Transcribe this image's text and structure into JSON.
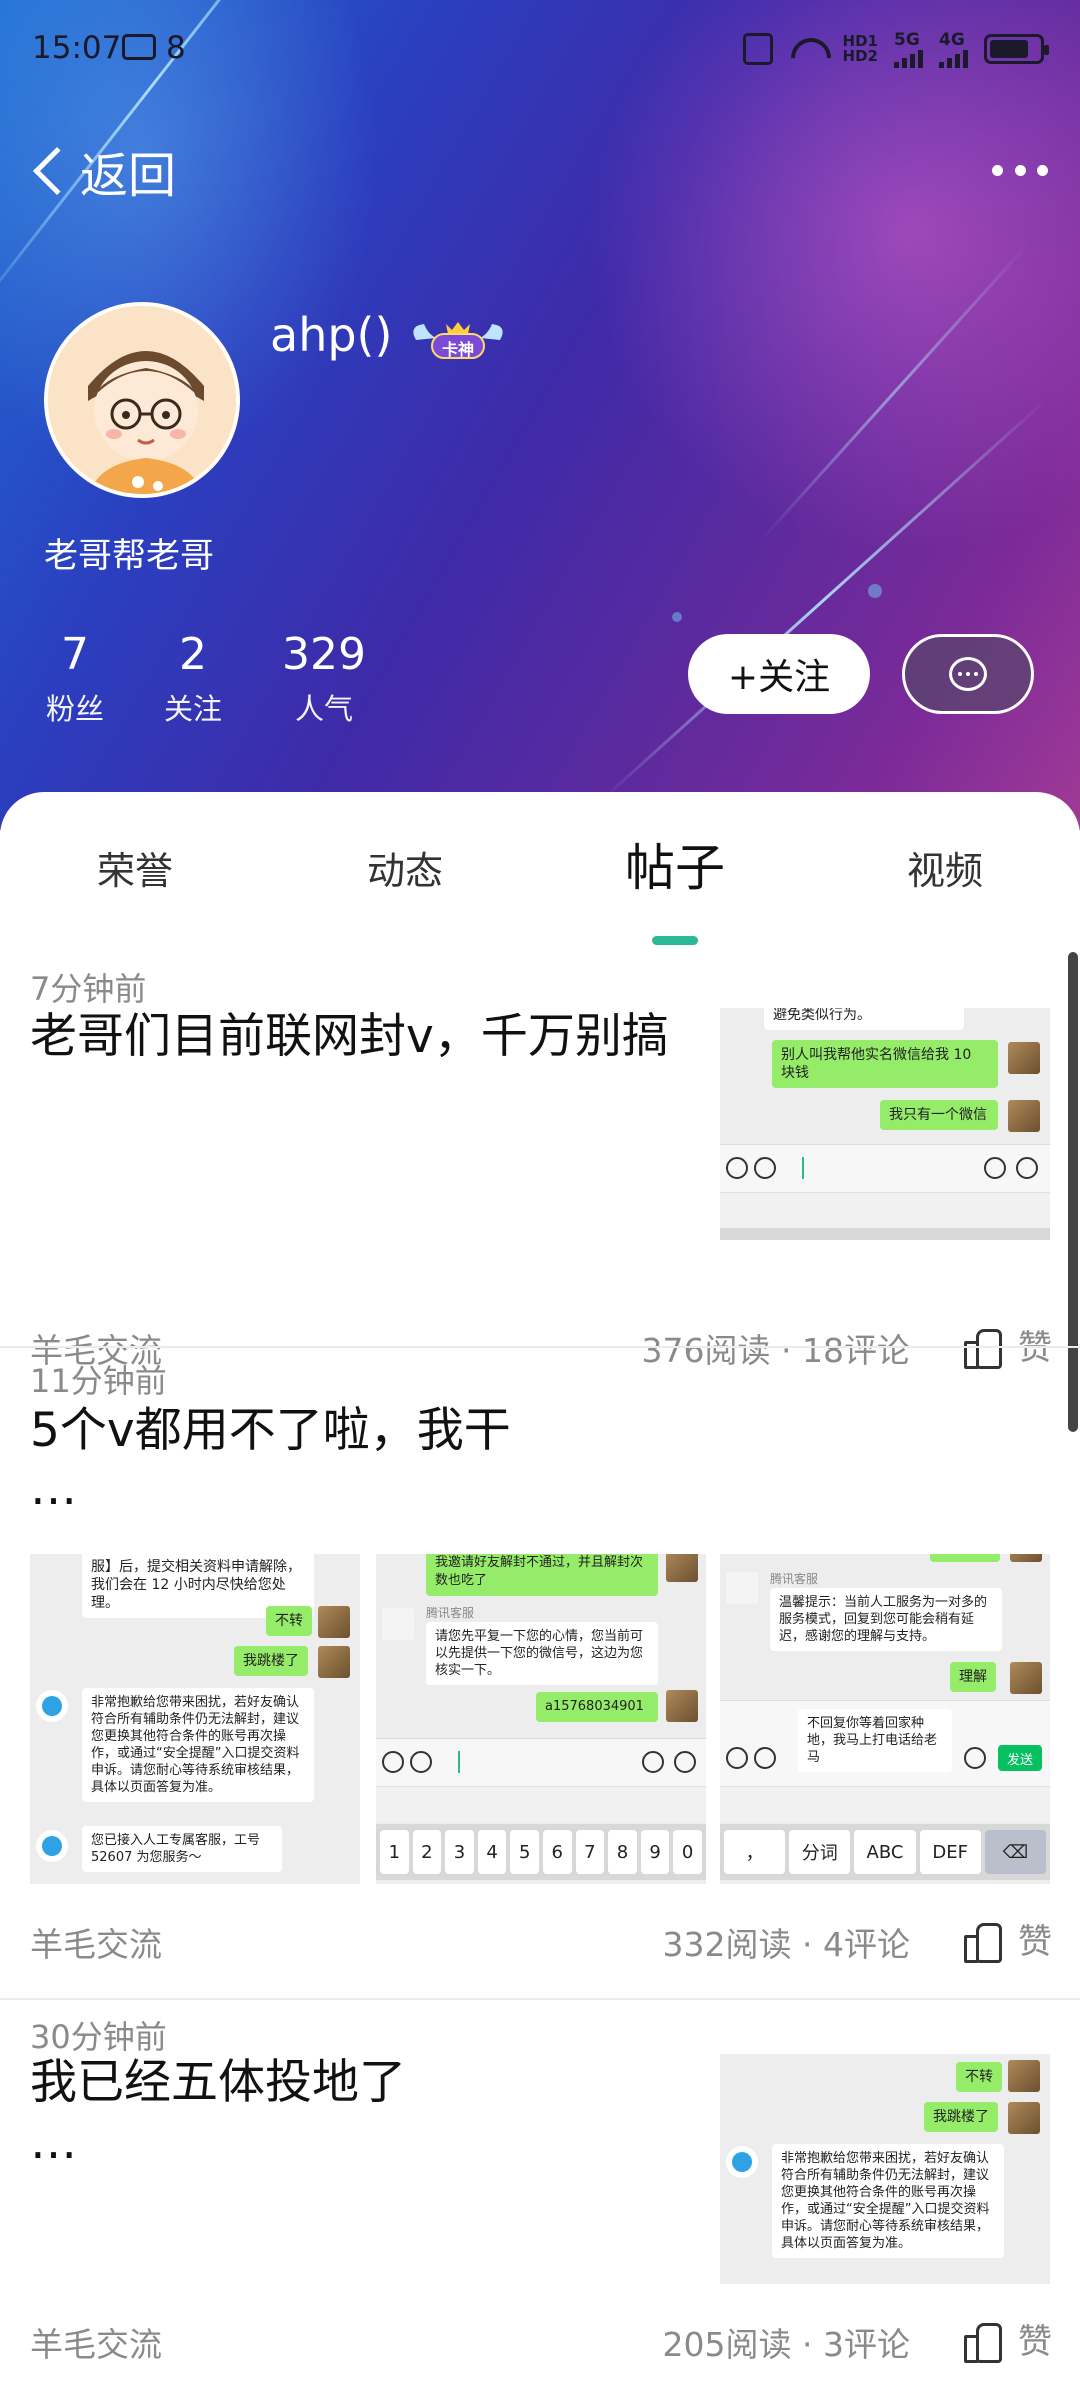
{
  "status_bar": {
    "time": "15:07",
    "notification_count": "8",
    "hd1": "HD1",
    "hd2": "HD2",
    "net1": "5G",
    "net2": "4G"
  },
  "nav": {
    "back_label": "返回"
  },
  "profile": {
    "username": "ahp()",
    "badge_label": "卡神",
    "bio": "老哥帮老哥",
    "stats": [
      {
        "value": "7",
        "label": "粉丝"
      },
      {
        "value": "2",
        "label": "关注"
      },
      {
        "value": "329",
        "label": "人气"
      }
    ],
    "follow_label": "+关注"
  },
  "tabs": [
    {
      "label": "荣誉",
      "active": false
    },
    {
      "label": "动态",
      "active": false
    },
    {
      "label": "帖子",
      "active": true
    },
    {
      "label": "视频",
      "active": false
    }
  ],
  "posts": [
    {
      "time": "7分钟前",
      "title": "老哥们目前联网封v，千万别搞",
      "tag": "羊毛交流",
      "stats": "376阅读 · 18评论",
      "like_label": "赞",
      "shot": {
        "line_top": "避免类似行为。",
        "me1": "别人叫我帮他实名微信给我 10 块钱",
        "me2": "我只有一个微信"
      }
    },
    {
      "time": "11分钟前",
      "title": "5个v都用不了啦，我干",
      "ellipsis": "…",
      "tag": "羊毛交流",
      "stats": "332阅读 · 4评论",
      "like_label": "赞",
      "shot1": {
        "top": "服】后，提交相关资料申请解除，我们会在 12 小时内尽快给您处理。",
        "me1": "不转",
        "me2": "我跳楼了",
        "bot1": "非常抱歉给您带来困扰，若好友确认符合所有辅助条件仍无法解封，建议您更换其他符合条件的账号再次操作，或通过“安全提醒”入口提交资料申诉。请您耐心等待系统审核结果，具体以页面答复为准。",
        "bot2": "您已接入人工专属客服，工号52607 为您服务～"
      },
      "shot2": {
        "me_top": "我邀请好友解封不通过，并且解封次数也吃了",
        "agent_name": "腾讯客服",
        "agent_msg": "请您先平复一下您的心情，您当前可以先提供一下您的微信号，这边为您核实一下。",
        "me_id": "a15768034901",
        "keys": [
          "1",
          "2",
          "3",
          "4",
          "5",
          "6",
          "7",
          "8",
          "9",
          "0"
        ]
      },
      "shot3": {
        "agent_name": "腾讯客服",
        "agent_msg": "温馨提示：当前人工服务为一对多的服务模式，回复到您可能会稍有延迟，感谢您的理解与支持。",
        "me1": "理解",
        "draft": "不回复你等着回家种地，我马上打电话给老马",
        "send": "发送",
        "keys": [
          "，",
          "分词",
          "ABC",
          "DEF",
          "⌫"
        ]
      }
    },
    {
      "time": "30分钟前",
      "title": "我已经五体投地了",
      "ellipsis": "…",
      "tag": "羊毛交流",
      "stats": "205阅读 · 3评论",
      "like_label": "赞",
      "shot": {
        "me1": "不转",
        "me2": "我跳楼了",
        "bot1": "非常抱歉给您带来困扰，若好友确认符合所有辅助条件仍无法解封，建议您更换其他符合条件的账号再次操作，或通过“安全提醒”入口提交资料申诉。请您耐心等待系统审核结果，具体以页面答复为准。"
      }
    }
  ],
  "colors": {
    "accent": "#2bb894",
    "wechat_green": "#95ec69",
    "muted_text": "#8a8a8a"
  }
}
